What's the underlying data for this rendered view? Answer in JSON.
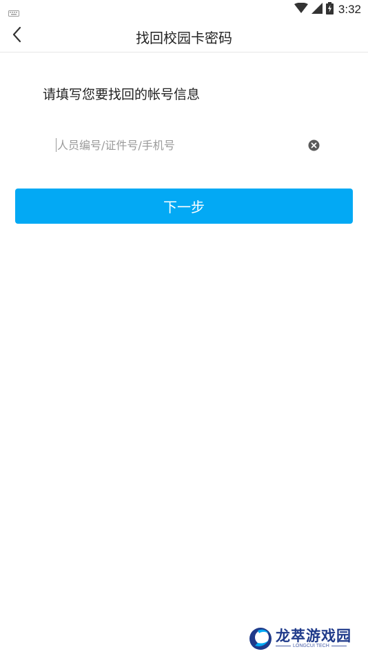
{
  "status_bar": {
    "time": "3:32",
    "icons": [
      "keyboard-icon",
      "wifi-icon",
      "signal-icon",
      "battery-icon"
    ]
  },
  "header": {
    "title": "找回校园卡密码",
    "back_icon": "chevron-left-icon"
  },
  "form": {
    "prompt": "请填写您要找回的帐号信息",
    "account_input": {
      "value": "",
      "placeholder": "人员编号/证件号/手机号"
    },
    "clear_icon": "clear-circle-icon",
    "next_label": "下一步"
  },
  "watermark": {
    "title": "龙萃游戏园",
    "subtitle": "LONGCUI TECH"
  },
  "colors": {
    "primary": "#03a9f4",
    "text": "#222222",
    "placeholder": "#9a9a9a",
    "watermark": "#1f3a8a"
  }
}
